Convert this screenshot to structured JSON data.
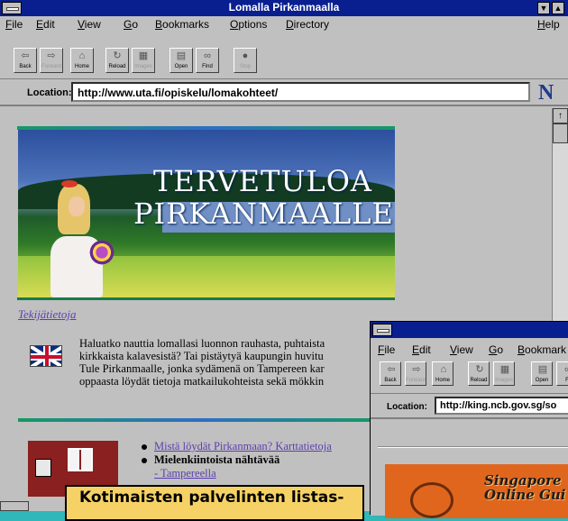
{
  "main_window": {
    "title": "Lomalla Pirkanmaalla",
    "menu": [
      "File",
      "Edit",
      "View",
      "Go",
      "Bookmarks",
      "Options",
      "Directory"
    ],
    "help": "Help",
    "toolbar": [
      "Back",
      "Forward",
      "Home",
      "Reload",
      "Images",
      "Open",
      "Find",
      "Stop"
    ],
    "location_label": "Location:",
    "location_url": "http://www.uta.fi/opiskelu/lomakohteet/",
    "logo_letter": "N"
  },
  "page": {
    "banner_line1": "TERVETULOA",
    "banner_line2": "PIRKANMAALLE",
    "credits_link": "Tekijätietoja",
    "intro_lines": [
      "Haluatko nauttia lomallasi luonnon rauhasta, puhtaista",
      "kirkkaista kalavesistä? Tai pistäytyä kaupungin huvitu",
      "Tule Pirkanmaalle, jonka sydämenä on Tampereen kar",
      "oppaasta löydät tietoja matkailukohteista sekä mökkin"
    ],
    "bullet_link": "Mistä löydät Pirkanmaan? Karttatietoja",
    "bullet_bold": "Mielenkiintoista nähtävää",
    "sub_link": "- Tampereella"
  },
  "caption": "Kotimaisten palvelinten listas-",
  "second_window": {
    "menu": [
      "File",
      "Edit",
      "View",
      "Go",
      "Bookmark"
    ],
    "toolbar": [
      "Back",
      "Forward",
      "Home",
      "Reload",
      "Images",
      "Open",
      "F"
    ],
    "location_label": "Location:",
    "location_url": "http://king.ncb.gov.sg/so",
    "banner_line1": "Singapore",
    "banner_line2": "Online Gui"
  }
}
